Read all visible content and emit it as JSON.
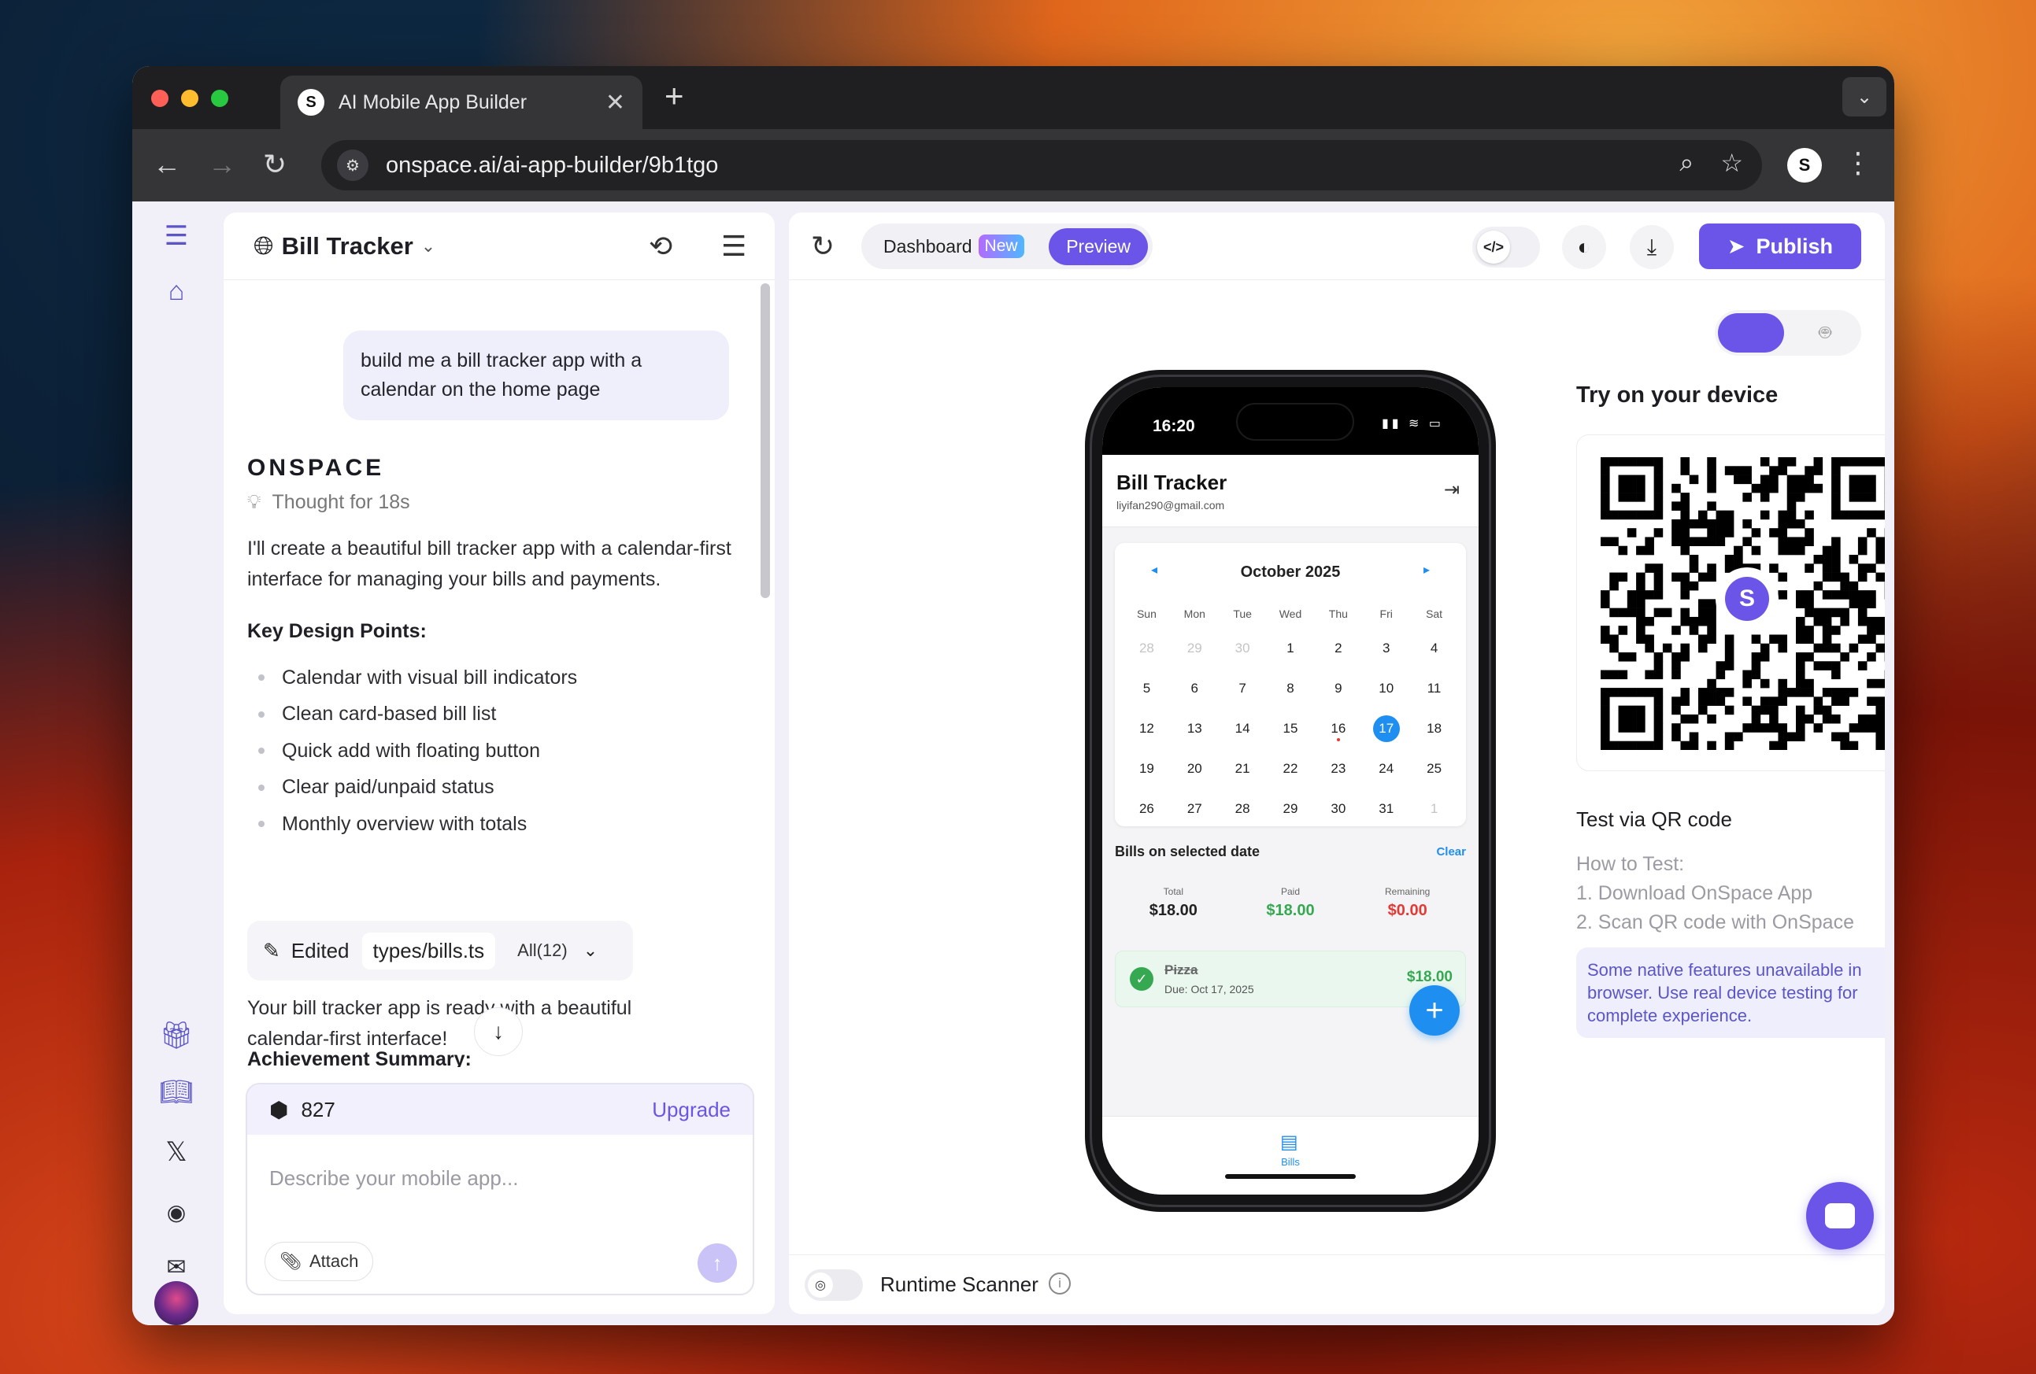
{
  "browser": {
    "tab_title": "AI Mobile App Builder",
    "tab_logo": "S",
    "url": "onspace.ai/ai-app-builder/9b1tgo",
    "new_tab": "+",
    "close": "✕"
  },
  "project": {
    "title": "Bill Tracker"
  },
  "chat": {
    "user_message": "build me a bill tracker app with a calendar on the home page",
    "brand": "ONSPACE",
    "thought": "Thought for 18s",
    "intro": "I'll create a beautiful bill tracker app with a calendar-first interface for managing your bills and payments.",
    "key_points_heading": "Key Design Points:",
    "key_points": [
      "Calendar with visual bill indicators",
      "Clean card-based bill list",
      "Quick add with floating button",
      "Clear paid/unpaid status",
      "Monthly overview with totals"
    ],
    "edited_label": "Edited",
    "edited_file": "types/bills.ts",
    "edited_all": "All(12)",
    "ready_text": "Your bill tracker app is ready with a beautiful calendar-first interface!",
    "achievement_heading": "Achievement Summary:"
  },
  "composer": {
    "credits": "827",
    "upgrade": "Upgrade",
    "placeholder": "Describe your mobile app...",
    "attach": "Attach"
  },
  "preview_header": {
    "dashboard": "Dashboard",
    "new_badge": "New",
    "preview": "Preview",
    "code_icon": "</>",
    "publish": "Publish"
  },
  "phone": {
    "time": "16:20",
    "app_title": "Bill Tracker",
    "email": "liyifan290@gmail.com",
    "month": "October 2025",
    "weekdays": [
      "Sun",
      "Mon",
      "Tue",
      "Wed",
      "Thu",
      "Fri",
      "Sat"
    ],
    "days": [
      "28",
      "29",
      "30",
      "1",
      "2",
      "3",
      "4",
      "5",
      "6",
      "7",
      "8",
      "9",
      "10",
      "11",
      "12",
      "13",
      "14",
      "15",
      "16",
      "17",
      "18",
      "19",
      "20",
      "21",
      "22",
      "23",
      "24",
      "25",
      "26",
      "27",
      "28",
      "29",
      "30",
      "31",
      "1"
    ],
    "selected_day": "17",
    "bills_title": "Bills on selected date",
    "clear": "Clear",
    "total_label": "Total",
    "total_value": "$18.00",
    "paid_label": "Paid",
    "paid_value": "$18.00",
    "remaining_label": "Remaining",
    "remaining_value": "$0.00",
    "bill_name": "Pizza",
    "bill_due": "Due: Oct 17, 2025",
    "bill_amount": "$18.00",
    "tab_label": "Bills"
  },
  "device": {
    "try_heading": "Try on your device",
    "test_via": "Test via QR code",
    "how_to": "How to Test:",
    "step1": "1. Download OnSpace App",
    "step2": "2. Scan QR code with OnSpace",
    "note": "Some native features unavailable in browser. Use real device testing for complete experience."
  },
  "scanner": {
    "label": "Runtime Scanner"
  },
  "colors": {
    "accent": "#6a55e8",
    "app_blue": "#1f8ef1",
    "paid_green": "#36a852",
    "remaining_red": "#e53935"
  }
}
